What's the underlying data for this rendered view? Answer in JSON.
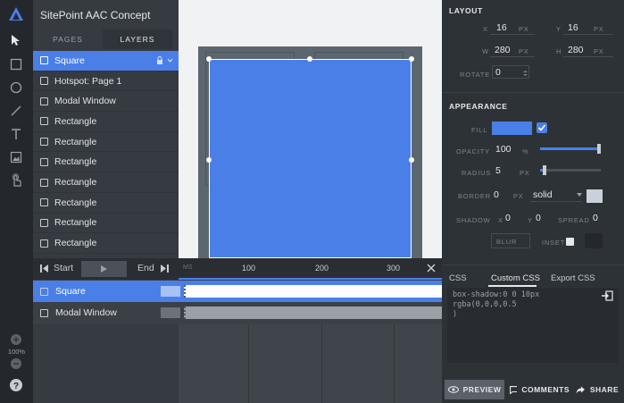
{
  "app": {
    "title": "SitePoint AAC Concept"
  },
  "toolbar": {
    "zoom": "100%"
  },
  "layers_panel": {
    "tabs": [
      "PAGES",
      "LAYERS"
    ],
    "active_tab": "LAYERS",
    "items": [
      {
        "label": "Square",
        "selected": true
      },
      {
        "label": "Hotspot: Page 1"
      },
      {
        "label": "Modal Window"
      },
      {
        "label": "Rectangle"
      },
      {
        "label": "Rectangle"
      },
      {
        "label": "Rectangle"
      },
      {
        "label": "Rectangle"
      },
      {
        "label": "Rectangle"
      },
      {
        "label": "Rectangle"
      },
      {
        "label": "Rectangle"
      }
    ]
  },
  "timeline": {
    "start_label": "Start",
    "end_label": "End",
    "ruler_start": "MS",
    "ruler_marks": [
      "100",
      "200",
      "300"
    ],
    "rows": [
      {
        "label": "Square",
        "selected": true
      },
      {
        "label": "Modal Window"
      }
    ]
  },
  "layout_section": {
    "title": "LAYOUT",
    "x_label": "X",
    "x_value": "16",
    "x_unit": "PX",
    "y_label": "Y",
    "y_value": "16",
    "y_unit": "PX",
    "w_label": "W",
    "w_value": "280",
    "w_unit": "PX",
    "h_label": "H",
    "h_value": "280",
    "h_unit": "PX",
    "rotate_label": "ROTATE",
    "rotate_value": "0"
  },
  "appearance": {
    "title": "APPEARANCE",
    "fill_label": "FILL",
    "fill_color": "#4a7fe8",
    "fill_enabled": true,
    "opacity_label": "OPACITY",
    "opacity_value": "100",
    "opacity_unit": "%",
    "opacity_level": 1.0,
    "radius_label": "RADIUS",
    "radius_value": "5",
    "radius_unit": "PX",
    "radius_level": 0.05,
    "border_label": "BORDER",
    "border_value": "0",
    "border_unit": "PX",
    "border_style": "solid",
    "shadow_label": "SHADOW",
    "shadow_x_label": "X",
    "shadow_x": "0",
    "shadow_y_label": "Y",
    "shadow_y": "0",
    "spread_label": "SPREAD",
    "spread_value": "0",
    "blur_label": "BLUR",
    "inset_label": "INSET"
  },
  "css_panel": {
    "tabs": [
      "CSS",
      "Custom CSS",
      "Export CSS"
    ],
    "active_tab": "Custom CSS",
    "code": "box-shadow:0 0 10px\nrgba(0,0,0,0.5\n)"
  },
  "bottom_bar": {
    "preview_label": "PREVIEW",
    "comments_label": "COMMENTS",
    "share_label": "SHARE"
  },
  "colors": {
    "accent": "#4a7fe8",
    "panel": "#363b41",
    "toolbar": "#24282d"
  }
}
